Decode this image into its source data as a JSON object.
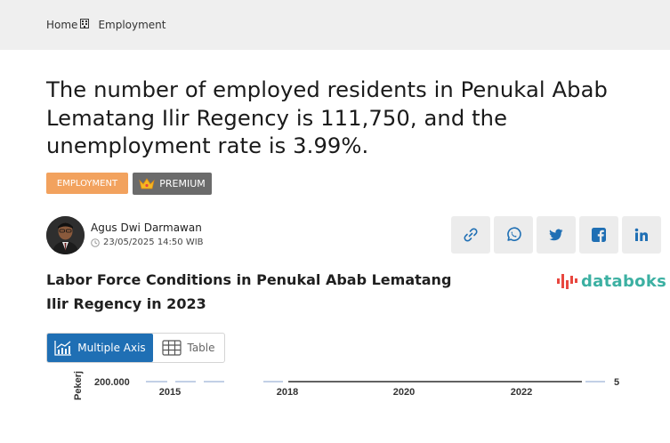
{
  "breadcrumb": {
    "home": "Home",
    "current": "Employment"
  },
  "article": {
    "title": "The number of employed residents in Penukal Abab Lematang Ilir Regency is 111,750, and the unemployment rate is 3.99%.",
    "tag": "EMPLOYMENT",
    "premium_label": "PREMIUM",
    "author_name": "Agus Dwi Darmawan",
    "date": "23/05/2025 14:50 WIB"
  },
  "share": {
    "icons": [
      "link-icon",
      "whatsapp-icon",
      "twitter-icon",
      "facebook-icon",
      "linkedin-icon"
    ]
  },
  "chart_section": {
    "title": "Labor Force Conditions in Penukal Abab Lematang Ilir Regency in 2023",
    "logo_text": "databoks",
    "toggle_multi_label": "Multiple Axis",
    "toggle_table_label": "Table"
  },
  "chart_data": {
    "type": "line",
    "ylabel": "Pekerj",
    "y_tick": "200.000",
    "right_tick": "5",
    "x_ticks": [
      "2015",
      "2018",
      "2020",
      "2022"
    ]
  },
  "colors": {
    "accent_blue": "#1f6fb4",
    "tag_orange": "#f2a25e",
    "premium_gray": "#6b6b6b",
    "databoks_teal": "#3cb0a2",
    "databoks_red": "#e8473f"
  }
}
